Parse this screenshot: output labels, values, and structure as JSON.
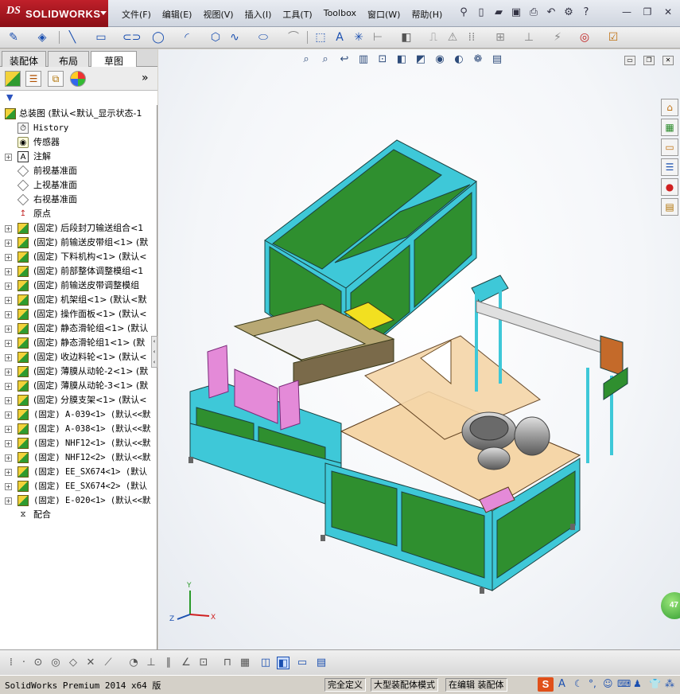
{
  "app": {
    "brand_ds": "DS",
    "brand_name": "SOLIDWORKS"
  },
  "menu": [
    "文件(F)",
    "编辑(E)",
    "视图(V)",
    "插入(I)",
    "工具(T)",
    "Toolbox",
    "窗口(W)",
    "帮助(H)"
  ],
  "panel": {
    "tabs": [
      "装配体",
      "布局",
      "草图"
    ],
    "active_tab": "草图",
    "root": "总装图  (默认<默认_显示状态-1",
    "items": [
      {
        "label": "History",
        "icon": "history-icon",
        "mono": true,
        "expand": false
      },
      {
        "label": "传感器",
        "icon": "sensor-icon",
        "mono": false,
        "expand": false
      },
      {
        "label": "注解",
        "icon": "annotation-icon",
        "mono": false,
        "expand": true
      },
      {
        "label": "前视基准面",
        "icon": "plane-icon",
        "mono": false,
        "expand": false
      },
      {
        "label": "上视基准面",
        "icon": "plane-icon",
        "mono": false,
        "expand": false
      },
      {
        "label": "右视基准面",
        "icon": "plane-icon",
        "mono": false,
        "expand": false
      },
      {
        "label": "原点",
        "icon": "origin-icon",
        "mono": false,
        "expand": false
      },
      {
        "label": "(固定) 后段封刀输送组合<1",
        "icon": "assembly-icon",
        "mono": false,
        "expand": true
      },
      {
        "label": "(固定) 前输送皮带组<1>  (默",
        "icon": "assembly-icon",
        "mono": false,
        "expand": true
      },
      {
        "label": "(固定) 下料机构<1>  (默认<",
        "icon": "assembly-icon",
        "mono": false,
        "expand": true
      },
      {
        "label": "(固定) 前部整体调整模组<1",
        "icon": "assembly-icon",
        "mono": false,
        "expand": true
      },
      {
        "label": "(固定) 前输送皮带调整模组",
        "icon": "assembly-icon",
        "mono": false,
        "expand": true
      },
      {
        "label": "(固定) 机架组<1>  (默认<默",
        "icon": "assembly-icon",
        "mono": false,
        "expand": true
      },
      {
        "label": "(固定) 操作面板<1>  (默认<",
        "icon": "assembly-icon",
        "mono": false,
        "expand": true
      },
      {
        "label": "(固定) 静态滑轮组<1>  (默认",
        "icon": "assembly-icon",
        "mono": false,
        "expand": true
      },
      {
        "label": "(固定) 静态滑轮组1<1>  (默",
        "icon": "assembly-icon",
        "mono": false,
        "expand": true
      },
      {
        "label": "(固定) 收边料轮<1>  (默认<",
        "icon": "assembly-icon",
        "mono": false,
        "expand": true
      },
      {
        "label": "(固定) 薄膜从动轮-2<1>  (默",
        "icon": "assembly-icon",
        "mono": false,
        "expand": true
      },
      {
        "label": "(固定) 薄膜从动轮-3<1>  (默",
        "icon": "assembly-icon",
        "mono": false,
        "expand": true
      },
      {
        "label": "(固定) 分膜支架<1>  (默认<",
        "icon": "assembly-icon",
        "mono": false,
        "expand": true
      },
      {
        "label": "(固定) A-039<1>  (默认<<默",
        "icon": "assembly-icon",
        "mono": true,
        "expand": true
      },
      {
        "label": "(固定) A-038<1>  (默认<<默",
        "icon": "assembly-icon",
        "mono": true,
        "expand": true
      },
      {
        "label": "(固定) NHF12<1>  (默认<<默",
        "icon": "assembly-icon",
        "mono": true,
        "expand": true
      },
      {
        "label": "(固定) NHF12<2>  (默认<<默",
        "icon": "assembly-icon",
        "mono": true,
        "expand": true
      },
      {
        "label": "(固定) EE_SX674<1>  (默认",
        "icon": "assembly-icon",
        "mono": true,
        "expand": true
      },
      {
        "label": "(固定) EE_SX674<2>  (默认",
        "icon": "assembly-icon",
        "mono": true,
        "expand": true
      },
      {
        "label": "(固定) E-020<1>  (默认<<默",
        "icon": "assembly-icon",
        "mono": true,
        "expand": true
      },
      {
        "label": "配合",
        "icon": "mates-icon",
        "mono": false,
        "expand": false
      }
    ]
  },
  "triad": {
    "x": "X",
    "y": "Y",
    "z": "Z"
  },
  "status": {
    "app": "SolidWorks Premium 2014 x64 版",
    "definition": "完全定义",
    "mode": "大型装配体模式",
    "editing": "在编辑 装配体",
    "badge": "47"
  },
  "colors": {
    "frame": "#2ec4d8",
    "panel": "#2c8a2c",
    "platen": "#f5d6a8",
    "pink": "#e48ad8"
  }
}
